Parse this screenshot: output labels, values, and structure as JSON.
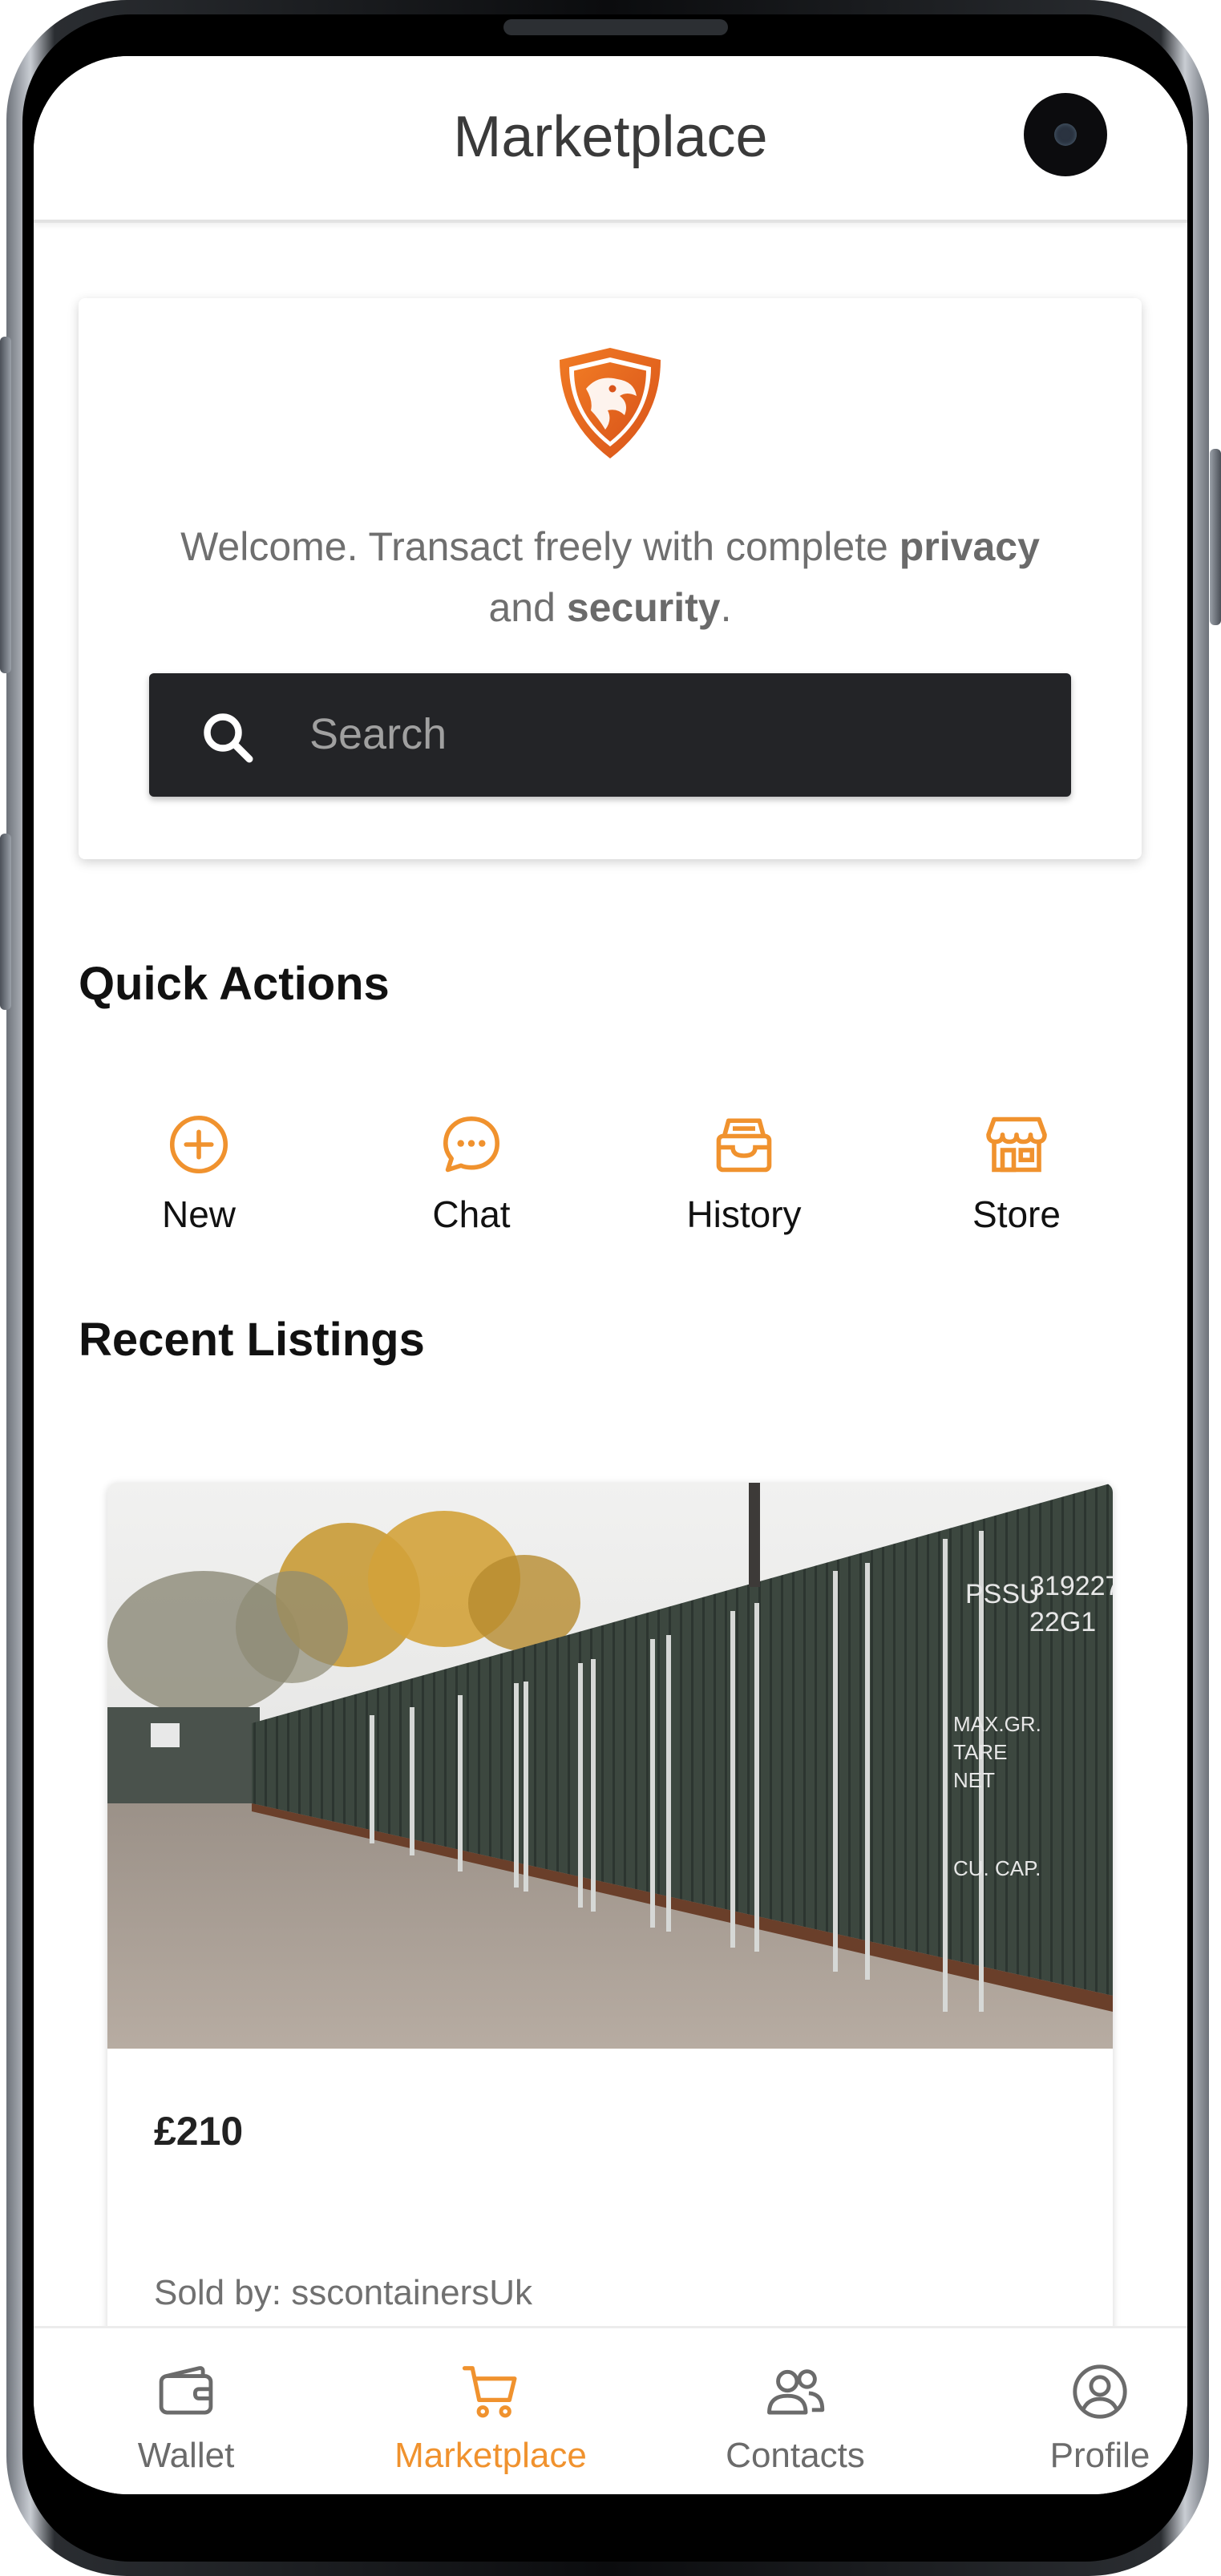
{
  "app": {
    "title": "Marketplace",
    "accent_color": "#f0922e"
  },
  "welcome": {
    "text_prefix": "Welcome. Transact freely with complete ",
    "bold_1": "privacy",
    "text_middle": " and ",
    "bold_2": "security",
    "text_suffix": ".",
    "logo_icon": "dragon-shield-logo"
  },
  "search": {
    "placeholder": "Search",
    "value": "",
    "icon": "search-icon"
  },
  "quick_actions": {
    "title": "Quick Actions",
    "items": [
      {
        "label": "New",
        "icon": "plus-circle-icon"
      },
      {
        "label": "Chat",
        "icon": "chat-bubble-icon"
      },
      {
        "label": "History",
        "icon": "inbox-tray-icon"
      },
      {
        "label": "Store",
        "icon": "storefront-icon"
      }
    ]
  },
  "recent_listings": {
    "title": "Recent Listings",
    "items": [
      {
        "price": "£210",
        "seller": "Sold by: sscontainersUk",
        "image": "shipping-containers-photo"
      }
    ]
  },
  "bottom_nav": {
    "active": "Marketplace",
    "items": [
      {
        "label": "Wallet",
        "icon": "wallet-icon"
      },
      {
        "label": "Marketplace",
        "icon": "cart-icon"
      },
      {
        "label": "Contacts",
        "icon": "users-icon"
      },
      {
        "label": "Profile",
        "icon": "user-circle-icon"
      }
    ]
  }
}
